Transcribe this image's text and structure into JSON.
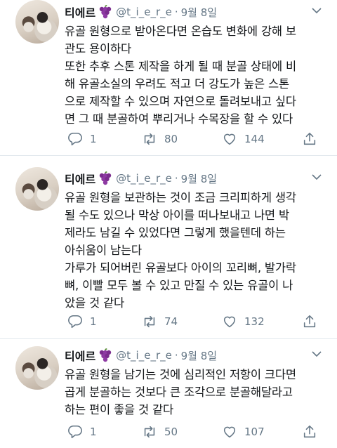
{
  "tweets": [
    {
      "display_name": "티에르",
      "handle": "@t_i_e_r_e",
      "separator": "·",
      "date": "9월 8일",
      "lines": [
        "유골 원형으로 받아온다면 온습도 변화에 강해 보",
        "관도 용이하다",
        "또한 추후 스톤 제작을 하게 될 때 분골 상태에 비",
        "해 유골소실의 우려도 적고 더 강도가 높은 스톤",
        "으로 제작할 수 있으며 자연으로 돌려보내고 싶다",
        "면 그 때 분골하여 뿌리거나 수목장을 할 수 있다"
      ],
      "reply_count": "1",
      "retweet_count": "80",
      "like_count": "144"
    },
    {
      "display_name": "티에르",
      "handle": "@t_i_e_r_e",
      "separator": "·",
      "date": "9월 8일",
      "lines": [
        "유골 원형을 보관하는 것이 조금 크리피하게 생각",
        "될 수도 있으나 막상 아이를 떠나보내고 나면 박",
        "제라도 남길 수 있었다면 그렇게 했을텐데 하는",
        "아쉬움이 남는다",
        "가루가 되어버린 유골보다 아이의 꼬리뼈, 발가락",
        "뼈, 이빨 모두 볼 수 있고 만질 수 있는 유골이 나",
        "았을 것 같다"
      ],
      "reply_count": "1",
      "retweet_count": "74",
      "like_count": "132"
    },
    {
      "display_name": "티에르",
      "handle": "@t_i_e_r_e",
      "separator": "·",
      "date": "9월 8일",
      "lines": [
        "유골 원형을 남기는 것에 심리적인 저항이 크다면",
        "곱게 분골하는 것보다 큰 조각으로 분골해달라고",
        "하는 편이 좋을 것 같다"
      ],
      "reply_count": "1",
      "retweet_count": "50",
      "like_count": "107"
    }
  ],
  "icons": {
    "badge": "grape-icon",
    "menu": "chevron-down-icon",
    "reply": "reply-icon",
    "retweet": "retweet-icon",
    "like": "heart-icon",
    "share": "share-icon"
  },
  "colors": {
    "text": "#14171a",
    "muted": "#657786",
    "divider": "#e1e8ed",
    "grape": "#7b2d8e"
  }
}
